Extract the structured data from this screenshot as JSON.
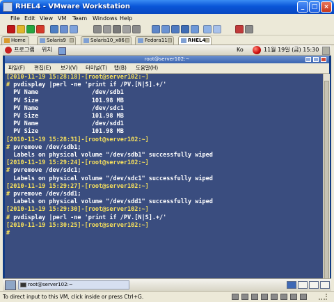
{
  "window": {
    "title": "RHEL4 - VMware Workstation"
  },
  "menubar": {
    "items": [
      "File",
      "Edit",
      "View",
      "VM",
      "Team",
      "Windows",
      "Help"
    ]
  },
  "tabs": [
    {
      "label": "Home",
      "active": false
    },
    {
      "label": "Solaris9",
      "active": false
    },
    {
      "label": "Solaris10_x86",
      "active": false
    },
    {
      "label": "Fedora11",
      "active": false
    },
    {
      "label": "RHEL4",
      "active": true
    }
  ],
  "guest_panel": {
    "applications": "프로그램",
    "places": "위치",
    "ime": "Ko",
    "clock": "11월 19일 (금)  15:30"
  },
  "terminal": {
    "title": "root@server102:~",
    "menu": [
      "파일(F)",
      "편집(E)",
      "보기(V)",
      "터미널(T)",
      "탭(B)",
      "도움말(H)"
    ],
    "lines": [
      {
        "prompt": "[2010-11-19 15:28:18]-[root@server102:~]",
        "text": ""
      },
      {
        "prompt": "#",
        "text": " pvdisplay |perl -ne 'print if /PV.[N|S].+/'"
      },
      {
        "prompt": "",
        "text": "  PV Name               /dev/sdb1"
      },
      {
        "prompt": "",
        "text": "  PV Size               101.98 MB"
      },
      {
        "prompt": "",
        "text": "  PV Name               /dev/sdc1"
      },
      {
        "prompt": "",
        "text": "  PV Size               101.98 MB"
      },
      {
        "prompt": "",
        "text": "  PV Name               /dev/sdd1"
      },
      {
        "prompt": "",
        "text": "  PV Size               101.98 MB"
      },
      {
        "prompt": "[2010-11-19 15:28:31]-[root@server102:~]",
        "text": ""
      },
      {
        "prompt": "#",
        "text": " pvremove /dev/sdb1;"
      },
      {
        "prompt": "",
        "text": "  Labels on physical volume \"/dev/sdb1\" successfully wiped"
      },
      {
        "prompt": "[2010-11-19 15:29:24]-[root@server102:~]",
        "text": ""
      },
      {
        "prompt": "#",
        "text": " pvremove /dev/sdc1;"
      },
      {
        "prompt": "",
        "text": "  Labels on physical volume \"/dev/sdc1\" successfully wiped"
      },
      {
        "prompt": "[2010-11-19 15:29:27]-[root@server102:~]",
        "text": ""
      },
      {
        "prompt": "#",
        "text": " pvremove /dev/sdd1;"
      },
      {
        "prompt": "",
        "text": "  Labels on physical volume \"/dev/sdd1\" successfully wiped"
      },
      {
        "prompt": "[2010-11-19 15:29:30]-[root@server102:~]",
        "text": ""
      },
      {
        "prompt": "#",
        "text": " pvdisplay |perl -ne 'print if /PV.[N|S].+/'"
      },
      {
        "prompt": "[2010-11-19 15:30:25]-[root@server102:~]",
        "text": ""
      },
      {
        "prompt": "#",
        "text": ""
      }
    ]
  },
  "taskbar": {
    "item": "root@server102:~"
  },
  "statusbar": {
    "text": "To direct input to this VM, click inside or press Ctrl+G."
  },
  "colors": {
    "terminal_bg": "#3a4d7f",
    "prompt": "#f6e05c",
    "title_bar": "#0a56d8"
  }
}
